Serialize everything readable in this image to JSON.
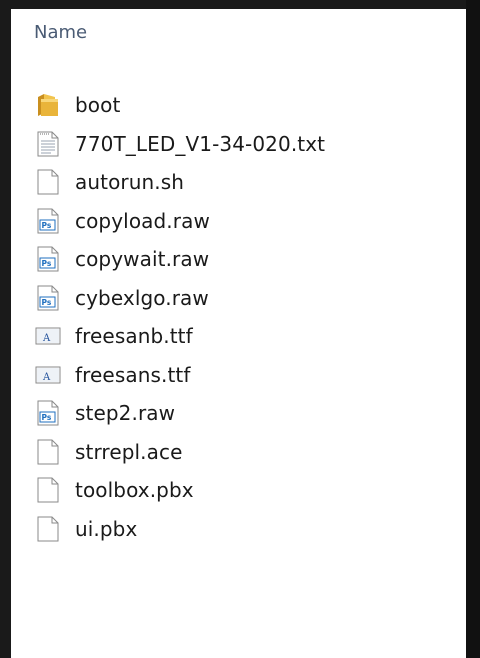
{
  "header": {
    "column_name": "Name"
  },
  "files": [
    {
      "name": "boot",
      "icon": "folder-icon"
    },
    {
      "name": "770T_LED_V1-34-020.txt",
      "icon": "text-file-icon"
    },
    {
      "name": "autorun.sh",
      "icon": "generic-file-icon"
    },
    {
      "name": "copyload.raw",
      "icon": "photoshop-file-icon"
    },
    {
      "name": "copywait.raw",
      "icon": "photoshop-file-icon"
    },
    {
      "name": "cybexlgo.raw",
      "icon": "photoshop-file-icon"
    },
    {
      "name": "freesanb.ttf",
      "icon": "font-file-icon"
    },
    {
      "name": "freesans.ttf",
      "icon": "font-file-icon"
    },
    {
      "name": "step2.raw",
      "icon": "photoshop-file-icon"
    },
    {
      "name": "strrepl.ace",
      "icon": "generic-file-icon"
    },
    {
      "name": "toolbox.pbx",
      "icon": "generic-file-icon"
    },
    {
      "name": "ui.pbx",
      "icon": "generic-file-icon"
    }
  ],
  "colors": {
    "header": "#4a5b74",
    "frame": "#1a1a1a",
    "folder": "#e9b43a",
    "ps_badge": "#1f6fbf"
  }
}
